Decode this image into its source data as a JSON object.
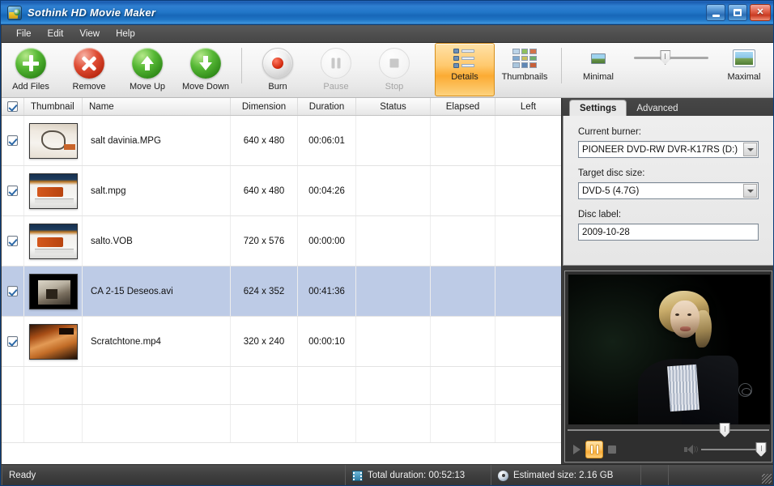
{
  "window": {
    "title": "Sothink HD Movie Maker",
    "icon": "app-logo-icon",
    "minimize_label": "Minimize",
    "maximize_label": "Maximize",
    "close_label": "Close"
  },
  "menubar": {
    "items": [
      {
        "label": "File"
      },
      {
        "label": "Edit"
      },
      {
        "label": "View"
      },
      {
        "label": "Help"
      }
    ]
  },
  "toolbar": {
    "buttons": [
      {
        "label": "Add Files",
        "icon": "add-circle-icon",
        "enabled": true
      },
      {
        "label": "Remove",
        "icon": "remove-circle-icon",
        "enabled": true
      },
      {
        "label": "Move Up",
        "icon": "arrow-up-circle-icon",
        "enabled": true
      },
      {
        "label": "Move Down",
        "icon": "arrow-down-circle-icon",
        "enabled": true
      },
      {
        "label": "Burn",
        "icon": "record-circle-icon",
        "enabled": true
      },
      {
        "label": "Pause",
        "icon": "pause-circle-icon",
        "enabled": false
      },
      {
        "label": "Stop",
        "icon": "stop-circle-icon",
        "enabled": false
      }
    ],
    "view_modes": [
      {
        "label": "Details",
        "icon": "details-view-icon",
        "active": true
      },
      {
        "label": "Thumbnails",
        "icon": "thumbnails-view-icon",
        "active": false
      }
    ],
    "size_slider": {
      "min_label": "Minimal",
      "max_label": "Maximal",
      "min_icon": "small-image-icon",
      "max_icon": "large-image-icon",
      "value_percent": 42
    }
  },
  "file_list": {
    "select_all_checked": true,
    "columns": [
      {
        "key": "check",
        "label": ""
      },
      {
        "key": "thumbnail",
        "label": "Thumbnail"
      },
      {
        "key": "name",
        "label": "Name"
      },
      {
        "key": "dimension",
        "label": "Dimension"
      },
      {
        "key": "duration",
        "label": "Duration"
      },
      {
        "key": "status",
        "label": "Status"
      },
      {
        "key": "elapsed",
        "label": "Elapsed"
      },
      {
        "key": "left",
        "label": "Left"
      }
    ],
    "rows": [
      {
        "checked": true,
        "thumb": "th1",
        "name": "salt davinia.MPG",
        "dimension": "640 x 480",
        "duration": "00:06:01",
        "status": "",
        "elapsed": "",
        "left": "",
        "selected": false
      },
      {
        "checked": true,
        "thumb": "th23",
        "name": "salt.mpg",
        "dimension": "640 x 480",
        "duration": "00:04:26",
        "status": "",
        "elapsed": "",
        "left": "",
        "selected": false
      },
      {
        "checked": true,
        "thumb": "th23",
        "name": "salto.VOB",
        "dimension": "720 x 576",
        "duration": "00:00:00",
        "status": "",
        "elapsed": "",
        "left": "",
        "selected": false
      },
      {
        "checked": true,
        "thumb": "th4",
        "name": "CA 2-15 Deseos.avi",
        "dimension": "624 x 352",
        "duration": "00:41:36",
        "status": "",
        "elapsed": "",
        "left": "",
        "selected": true
      },
      {
        "checked": true,
        "thumb": "th5",
        "name": "Scratchtone.mp4",
        "dimension": "320 x 240",
        "duration": "00:00:10",
        "status": "",
        "elapsed": "",
        "left": "",
        "selected": false
      }
    ]
  },
  "right_panel": {
    "tabs": [
      {
        "label": "Settings",
        "active": true
      },
      {
        "label": "Advanced",
        "active": false
      }
    ],
    "settings": {
      "burner_label": "Current burner:",
      "burner_value": "PIONEER DVD-RW DVR-K17RS (D:)",
      "disc_size_label": "Target disc size:",
      "disc_size_value": "DVD-5 (4.7G)",
      "disc_label_label": "Disc label:",
      "disc_label_value": "2009-10-28"
    },
    "preview": {
      "alt": "video-preview-frame",
      "seek_percent": 78,
      "volume_percent": 100,
      "controls": [
        {
          "name": "play",
          "label": "Play",
          "active": false
        },
        {
          "name": "pause",
          "label": "Pause",
          "active": true
        },
        {
          "name": "stop",
          "label": "Stop",
          "active": false
        }
      ],
      "volume_icon": "speaker-icon"
    }
  },
  "statusbar": {
    "ready_text": "Ready",
    "total_duration": "Total duration: 00:52:13",
    "estimated_size": "Estimated size: 2.16 GB",
    "duration_icon": "film-strip-icon",
    "size_icon": "disc-icon"
  },
  "colors": {
    "titlebar_blue": "#2277c9",
    "accent_orange": "#fbab33",
    "selection_blue": "#bdcbe6",
    "chrome_dark": "#3c3c3c"
  }
}
